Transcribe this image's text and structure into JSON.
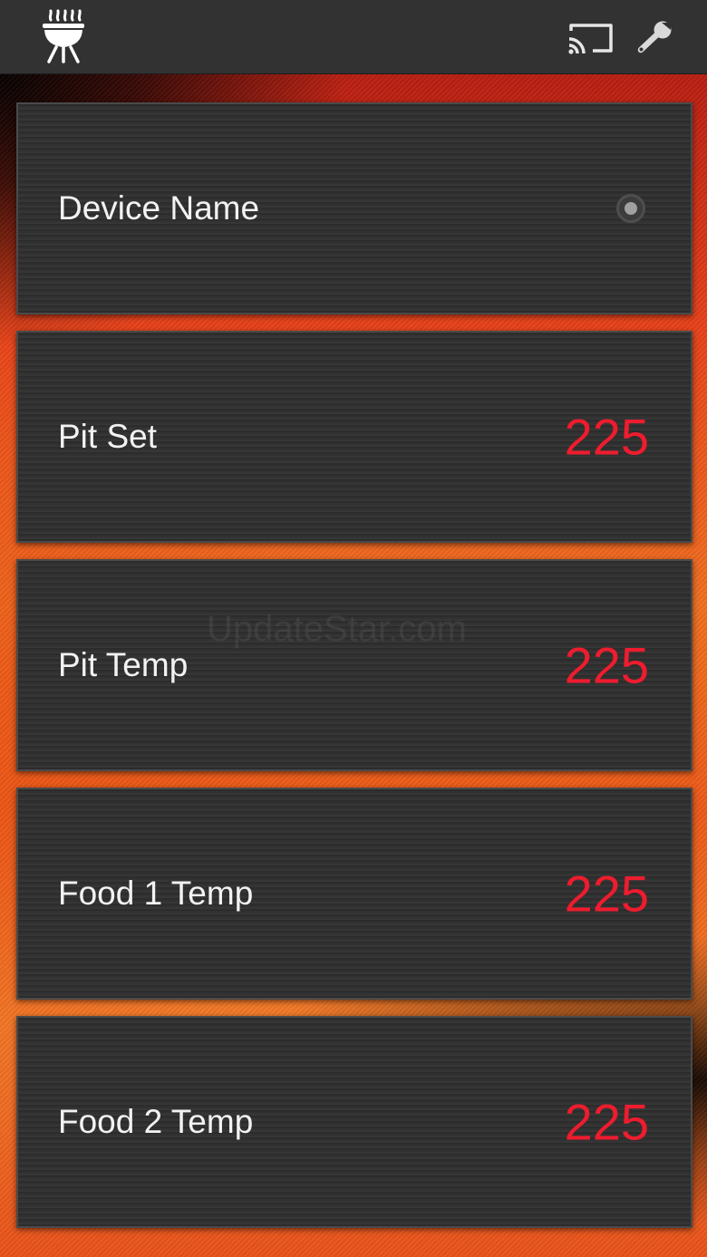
{
  "header": {
    "logo_icon": "grill-icon",
    "actions": [
      {
        "icon": "cast-icon"
      },
      {
        "icon": "wrench-icon"
      }
    ]
  },
  "device": {
    "label": "Device Name",
    "status_icon": "connection-status-icon"
  },
  "readings": [
    {
      "label": "Pit Set",
      "value": "225"
    },
    {
      "label": "Pit Temp",
      "value": "225"
    },
    {
      "label": "Food 1 Temp",
      "value": "225"
    },
    {
      "label": "Food 2 Temp",
      "value": "225"
    }
  ],
  "watermark": "UpdateStar.com",
  "colors": {
    "value_red": "#ee1c2e",
    "header_bg": "#323232",
    "card_bg": "#303030",
    "accent_orange": "#f07020"
  }
}
